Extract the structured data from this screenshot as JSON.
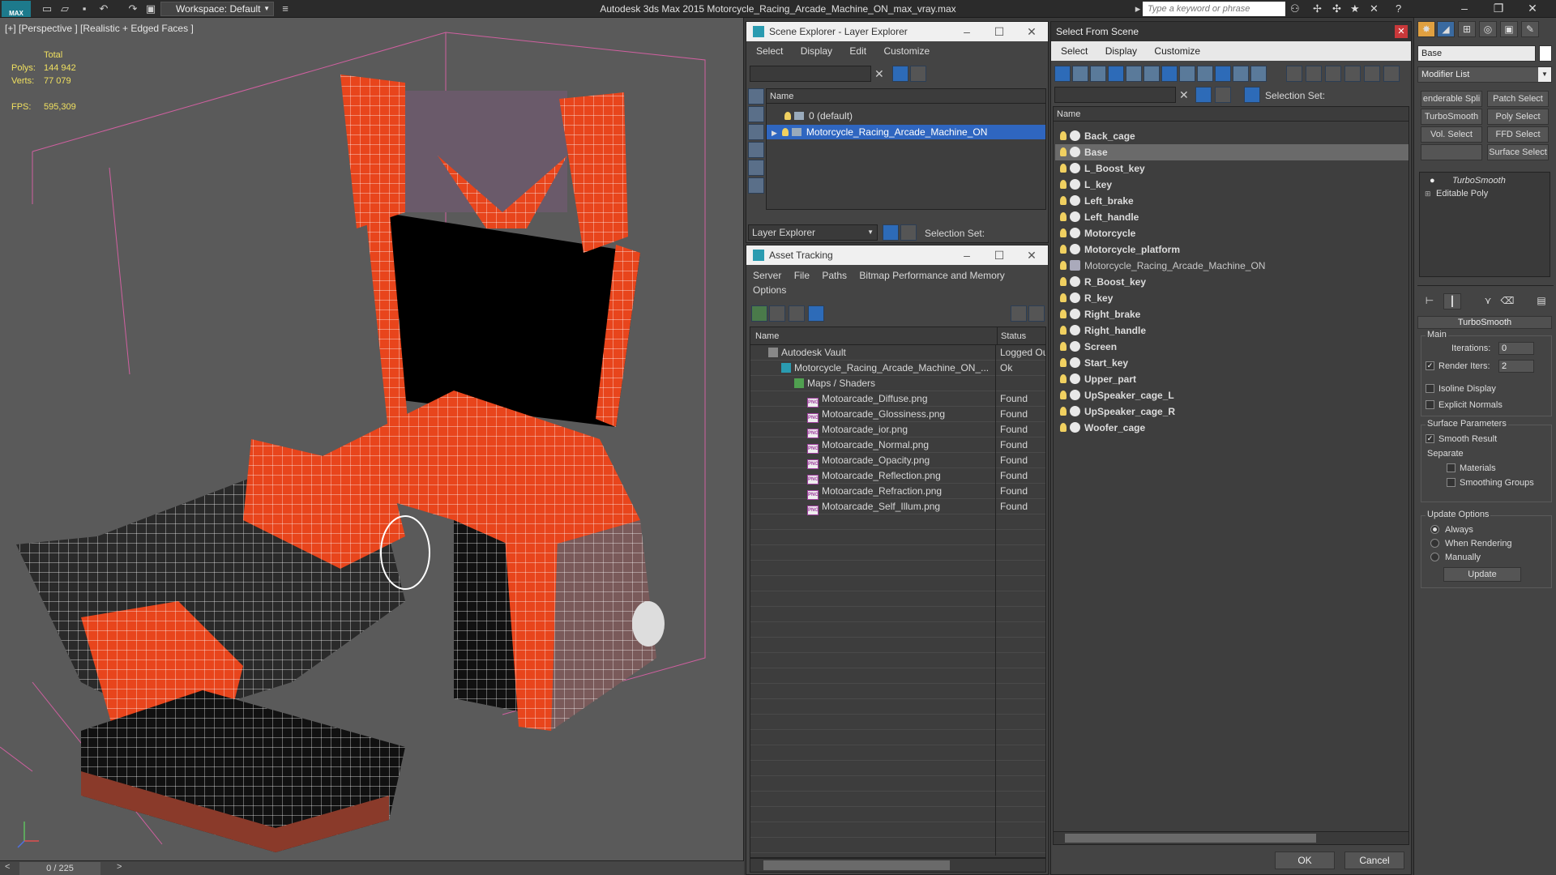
{
  "app": {
    "title": "Autodesk 3ds Max  2015     Motorcycle_Racing_Arcade_Machine_ON_max_vray.max",
    "logo": "MAX",
    "workspace": "Workspace: Default",
    "search_placeholder": "Type a keyword or phrase"
  },
  "viewport": {
    "label": "[+] [Perspective ] [Realistic + Edged Faces ]",
    "stats": {
      "total_label": "Total",
      "polys_label": "Polys:",
      "polys_value": "144 942",
      "verts_label": "Verts:",
      "verts_value": "77 079",
      "fps_label": "FPS:",
      "fps_value": "595,309"
    },
    "frame": "0 / 225",
    "colors": {
      "wire": "#ffffff",
      "shell": "#e8451c",
      "seat": "#2a2a2a",
      "bbox": "#d060a0"
    }
  },
  "scene_explorer": {
    "title": "Scene Explorer - Layer Explorer",
    "menu": [
      "Select",
      "Display",
      "Edit",
      "Customize"
    ],
    "column": "Name",
    "rows": [
      {
        "label": "0 (default)",
        "selected": false
      },
      {
        "label": "Motorcycle_Racing_Arcade_Machine_ON",
        "selected": true
      }
    ],
    "footer_dropdown": "Layer Explorer",
    "selection_set_label": "Selection Set:"
  },
  "asset_tracking": {
    "title": "Asset Tracking",
    "menu": [
      "Server",
      "File",
      "Paths",
      "Bitmap Performance and Memory",
      "Options"
    ],
    "columns": {
      "name": "Name",
      "status": "Status"
    },
    "rows": [
      {
        "name": "Autodesk Vault",
        "status": "Logged Out",
        "indent": 1,
        "icon": "vault-icon"
      },
      {
        "name": "Motorcycle_Racing_Arcade_Machine_ON_...",
        "status": "Ok",
        "indent": 2,
        "icon": "max-file-icon"
      },
      {
        "name": "Maps / Shaders",
        "status": "",
        "indent": 3,
        "icon": "maps-icon"
      },
      {
        "name": "Motoarcade_Diffuse.png",
        "status": "Found",
        "indent": 4,
        "icon": "png-icon"
      },
      {
        "name": "Motoarcade_Glossiness.png",
        "status": "Found",
        "indent": 4,
        "icon": "png-icon"
      },
      {
        "name": "Motoarcade_ior.png",
        "status": "Found",
        "indent": 4,
        "icon": "png-icon"
      },
      {
        "name": "Motoarcade_Normal.png",
        "status": "Found",
        "indent": 4,
        "icon": "png-icon"
      },
      {
        "name": "Motoarcade_Opacity.png",
        "status": "Found",
        "indent": 4,
        "icon": "png-icon"
      },
      {
        "name": "Motoarcade_Reflection.png",
        "status": "Found",
        "indent": 4,
        "icon": "png-icon"
      },
      {
        "name": "Motoarcade_Refraction.png",
        "status": "Found",
        "indent": 4,
        "icon": "png-icon"
      },
      {
        "name": "Motoarcade_Self_Illum.png",
        "status": "Found",
        "indent": 4,
        "icon": "png-icon"
      }
    ]
  },
  "select_from_scene": {
    "title": "Select From Scene",
    "menu": [
      "Select",
      "Display",
      "Customize"
    ],
    "selection_set_label": "Selection Set:",
    "column": "Name",
    "items": [
      {
        "label": "Back_cage",
        "highlight": false,
        "bold": true
      },
      {
        "label": "Base",
        "highlight": true,
        "bold": true
      },
      {
        "label": "L_Boost_key",
        "highlight": false,
        "bold": true
      },
      {
        "label": "L_key",
        "highlight": false,
        "bold": true
      },
      {
        "label": "Left_brake",
        "highlight": false,
        "bold": true
      },
      {
        "label": "Left_handle",
        "highlight": false,
        "bold": true
      },
      {
        "label": "Motorcycle",
        "highlight": false,
        "bold": true
      },
      {
        "label": "Motorcycle_platform",
        "highlight": false,
        "bold": true
      },
      {
        "label": "Motorcycle_Racing_Arcade_Machine_ON",
        "highlight": false,
        "bold": false
      },
      {
        "label": "R_Boost_key",
        "highlight": false,
        "bold": true
      },
      {
        "label": "R_key",
        "highlight": false,
        "bold": true
      },
      {
        "label": "Right_brake",
        "highlight": false,
        "bold": true
      },
      {
        "label": "Right_handle",
        "highlight": false,
        "bold": true
      },
      {
        "label": "Screen",
        "highlight": false,
        "bold": true
      },
      {
        "label": "Start_key",
        "highlight": false,
        "bold": true
      },
      {
        "label": "Upper_part",
        "highlight": false,
        "bold": true
      },
      {
        "label": "UpSpeaker_cage_L",
        "highlight": false,
        "bold": true
      },
      {
        "label": "UpSpeaker_cage_R",
        "highlight": false,
        "bold": true
      },
      {
        "label": "Woofer_cage",
        "highlight": false,
        "bold": true
      }
    ],
    "ok_label": "OK",
    "cancel_label": "Cancel"
  },
  "command_panel": {
    "object_name": "Base",
    "modifier_list": "Modifier List",
    "mod_buttons": [
      "enderable Spli",
      "Patch Select",
      "TurboSmooth",
      "Poly Select",
      "Vol. Select",
      "FFD Select",
      "",
      "Surface Select"
    ],
    "stack": [
      "TurboSmooth",
      "Editable Poly"
    ],
    "turbosmooth": {
      "title": "TurboSmooth",
      "main_label": "Main",
      "iterations_label": "Iterations:",
      "iterations_value": "0",
      "render_iters_label": "Render Iters:",
      "render_iters_value": "2",
      "isoline_label": "Isoline Display",
      "explicit_normals_label": "Explicit Normals",
      "surface_params_label": "Surface Parameters",
      "smooth_result_label": "Smooth Result",
      "separate_label": "Separate",
      "materials_label": "Materials",
      "smoothing_groups_label": "Smoothing Groups",
      "update_options_label": "Update Options",
      "always_label": "Always",
      "when_rendering_label": "When Rendering",
      "manually_label": "Manually",
      "update_button": "Update"
    }
  }
}
